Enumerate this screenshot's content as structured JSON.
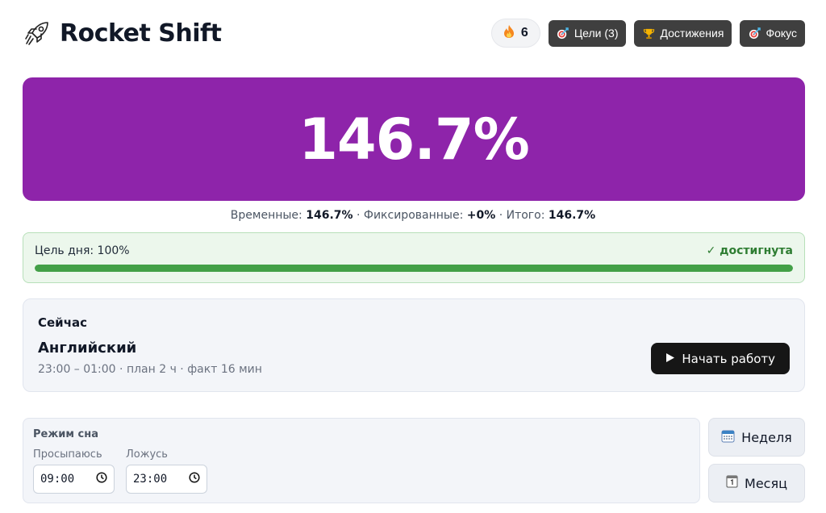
{
  "app": {
    "title": "Rocket Shift"
  },
  "header": {
    "streak": {
      "icon": "fire-icon",
      "count": "6"
    },
    "buttons": [
      {
        "label": "Цели (3)",
        "icon": "target-icon"
      },
      {
        "label": "Достижения",
        "icon": "trophy-icon"
      },
      {
        "label": "Фокус",
        "icon": "target-icon"
      }
    ]
  },
  "hero": {
    "value": "146.7%",
    "color": "#8e24aa"
  },
  "summary": {
    "temporary_label": "Временные:",
    "temporary_value": "146.7%",
    "sep1": "·",
    "fixed_label": "Фиксированные:",
    "fixed_value": "+0%",
    "sep2": "·",
    "total_label": "Итого:",
    "total_value": "146.7%"
  },
  "goal": {
    "label": "Цель дня: 100%",
    "status": "✓ достигнута",
    "progress_percent": 100
  },
  "now": {
    "label": "Сейчас",
    "task": "Английский",
    "meta": "23:00 – 01:00 · план 2 ч · факт 16 мин",
    "start_label": "Начать работу"
  },
  "sleep": {
    "title": "Режим сна",
    "wake_label": "Просыпаюсь",
    "wake_value": "09:00",
    "bed_label": "Ложусь",
    "bed_value": "23:00"
  },
  "side": {
    "week_label": "Неделя",
    "month_label": "Месяц"
  },
  "colors": {
    "accent": "#8e24aa",
    "success": "#43a047",
    "dark_button": "#3f3f3f"
  }
}
